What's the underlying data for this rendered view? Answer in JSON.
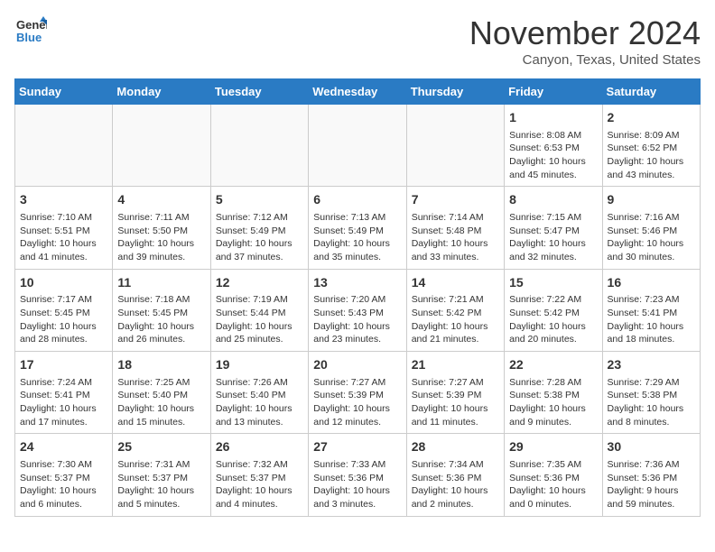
{
  "logo": {
    "line1": "General",
    "line2": "Blue"
  },
  "title": "November 2024",
  "subtitle": "Canyon, Texas, United States",
  "weekdays": [
    "Sunday",
    "Monday",
    "Tuesday",
    "Wednesday",
    "Thursday",
    "Friday",
    "Saturday"
  ],
  "weeks": [
    [
      {
        "day": "",
        "info": ""
      },
      {
        "day": "",
        "info": ""
      },
      {
        "day": "",
        "info": ""
      },
      {
        "day": "",
        "info": ""
      },
      {
        "day": "",
        "info": ""
      },
      {
        "day": "1",
        "info": "Sunrise: 8:08 AM\nSunset: 6:53 PM\nDaylight: 10 hours and 45 minutes."
      },
      {
        "day": "2",
        "info": "Sunrise: 8:09 AM\nSunset: 6:52 PM\nDaylight: 10 hours and 43 minutes."
      }
    ],
    [
      {
        "day": "3",
        "info": "Sunrise: 7:10 AM\nSunset: 5:51 PM\nDaylight: 10 hours and 41 minutes."
      },
      {
        "day": "4",
        "info": "Sunrise: 7:11 AM\nSunset: 5:50 PM\nDaylight: 10 hours and 39 minutes."
      },
      {
        "day": "5",
        "info": "Sunrise: 7:12 AM\nSunset: 5:49 PM\nDaylight: 10 hours and 37 minutes."
      },
      {
        "day": "6",
        "info": "Sunrise: 7:13 AM\nSunset: 5:49 PM\nDaylight: 10 hours and 35 minutes."
      },
      {
        "day": "7",
        "info": "Sunrise: 7:14 AM\nSunset: 5:48 PM\nDaylight: 10 hours and 33 minutes."
      },
      {
        "day": "8",
        "info": "Sunrise: 7:15 AM\nSunset: 5:47 PM\nDaylight: 10 hours and 32 minutes."
      },
      {
        "day": "9",
        "info": "Sunrise: 7:16 AM\nSunset: 5:46 PM\nDaylight: 10 hours and 30 minutes."
      }
    ],
    [
      {
        "day": "10",
        "info": "Sunrise: 7:17 AM\nSunset: 5:45 PM\nDaylight: 10 hours and 28 minutes."
      },
      {
        "day": "11",
        "info": "Sunrise: 7:18 AM\nSunset: 5:45 PM\nDaylight: 10 hours and 26 minutes."
      },
      {
        "day": "12",
        "info": "Sunrise: 7:19 AM\nSunset: 5:44 PM\nDaylight: 10 hours and 25 minutes."
      },
      {
        "day": "13",
        "info": "Sunrise: 7:20 AM\nSunset: 5:43 PM\nDaylight: 10 hours and 23 minutes."
      },
      {
        "day": "14",
        "info": "Sunrise: 7:21 AM\nSunset: 5:42 PM\nDaylight: 10 hours and 21 minutes."
      },
      {
        "day": "15",
        "info": "Sunrise: 7:22 AM\nSunset: 5:42 PM\nDaylight: 10 hours and 20 minutes."
      },
      {
        "day": "16",
        "info": "Sunrise: 7:23 AM\nSunset: 5:41 PM\nDaylight: 10 hours and 18 minutes."
      }
    ],
    [
      {
        "day": "17",
        "info": "Sunrise: 7:24 AM\nSunset: 5:41 PM\nDaylight: 10 hours and 17 minutes."
      },
      {
        "day": "18",
        "info": "Sunrise: 7:25 AM\nSunset: 5:40 PM\nDaylight: 10 hours and 15 minutes."
      },
      {
        "day": "19",
        "info": "Sunrise: 7:26 AM\nSunset: 5:40 PM\nDaylight: 10 hours and 13 minutes."
      },
      {
        "day": "20",
        "info": "Sunrise: 7:27 AM\nSunset: 5:39 PM\nDaylight: 10 hours and 12 minutes."
      },
      {
        "day": "21",
        "info": "Sunrise: 7:27 AM\nSunset: 5:39 PM\nDaylight: 10 hours and 11 minutes."
      },
      {
        "day": "22",
        "info": "Sunrise: 7:28 AM\nSunset: 5:38 PM\nDaylight: 10 hours and 9 minutes."
      },
      {
        "day": "23",
        "info": "Sunrise: 7:29 AM\nSunset: 5:38 PM\nDaylight: 10 hours and 8 minutes."
      }
    ],
    [
      {
        "day": "24",
        "info": "Sunrise: 7:30 AM\nSunset: 5:37 PM\nDaylight: 10 hours and 6 minutes."
      },
      {
        "day": "25",
        "info": "Sunrise: 7:31 AM\nSunset: 5:37 PM\nDaylight: 10 hours and 5 minutes."
      },
      {
        "day": "26",
        "info": "Sunrise: 7:32 AM\nSunset: 5:37 PM\nDaylight: 10 hours and 4 minutes."
      },
      {
        "day": "27",
        "info": "Sunrise: 7:33 AM\nSunset: 5:36 PM\nDaylight: 10 hours and 3 minutes."
      },
      {
        "day": "28",
        "info": "Sunrise: 7:34 AM\nSunset: 5:36 PM\nDaylight: 10 hours and 2 minutes."
      },
      {
        "day": "29",
        "info": "Sunrise: 7:35 AM\nSunset: 5:36 PM\nDaylight: 10 hours and 0 minutes."
      },
      {
        "day": "30",
        "info": "Sunrise: 7:36 AM\nSunset: 5:36 PM\nDaylight: 9 hours and 59 minutes."
      }
    ]
  ]
}
